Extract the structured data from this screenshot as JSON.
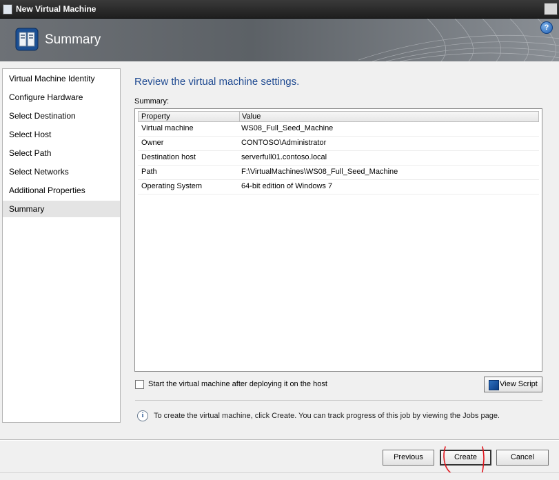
{
  "window": {
    "title": "New Virtual Machine"
  },
  "header": {
    "title": "Summary",
    "help_icon": "help-icon",
    "help_glyph": "?"
  },
  "nav": {
    "items": [
      {
        "label": "Virtual Machine Identity",
        "active": false
      },
      {
        "label": "Configure Hardware",
        "active": false
      },
      {
        "label": "Select Destination",
        "active": false
      },
      {
        "label": "Select Host",
        "active": false
      },
      {
        "label": "Select Path",
        "active": false
      },
      {
        "label": "Select Networks",
        "active": false
      },
      {
        "label": "Additional Properties",
        "active": false
      },
      {
        "label": "Summary",
        "active": true
      }
    ]
  },
  "main": {
    "title": "Review the virtual machine settings.",
    "summary_label": "Summary:",
    "table": {
      "columns": [
        "Property",
        "Value"
      ],
      "rows": [
        {
          "property": "Virtual machine",
          "value": "WS08_Full_Seed_Machine"
        },
        {
          "property": "Owner",
          "value": "CONTOSO\\Administrator"
        },
        {
          "property": "Destination host",
          "value": "serverfull01.contoso.local"
        },
        {
          "property": "Path",
          "value": "F:\\VirtualMachines\\WS08_Full_Seed_Machine"
        },
        {
          "property": "Operating System",
          "value": "64-bit edition of Windows 7"
        }
      ]
    },
    "start_vm_checkbox": {
      "label": "Start the virtual machine after deploying it on the host",
      "checked": false
    },
    "view_script_label": "View Script",
    "info_glyph": "i",
    "info_text": "To create the virtual machine, click Create.  You can track progress of this job by viewing the Jobs page."
  },
  "footer": {
    "previous_label": "Previous",
    "create_label": "Create",
    "cancel_label": "Cancel"
  },
  "colors": {
    "accent_title": "#1f4a91",
    "annotation": "#e0141c"
  }
}
